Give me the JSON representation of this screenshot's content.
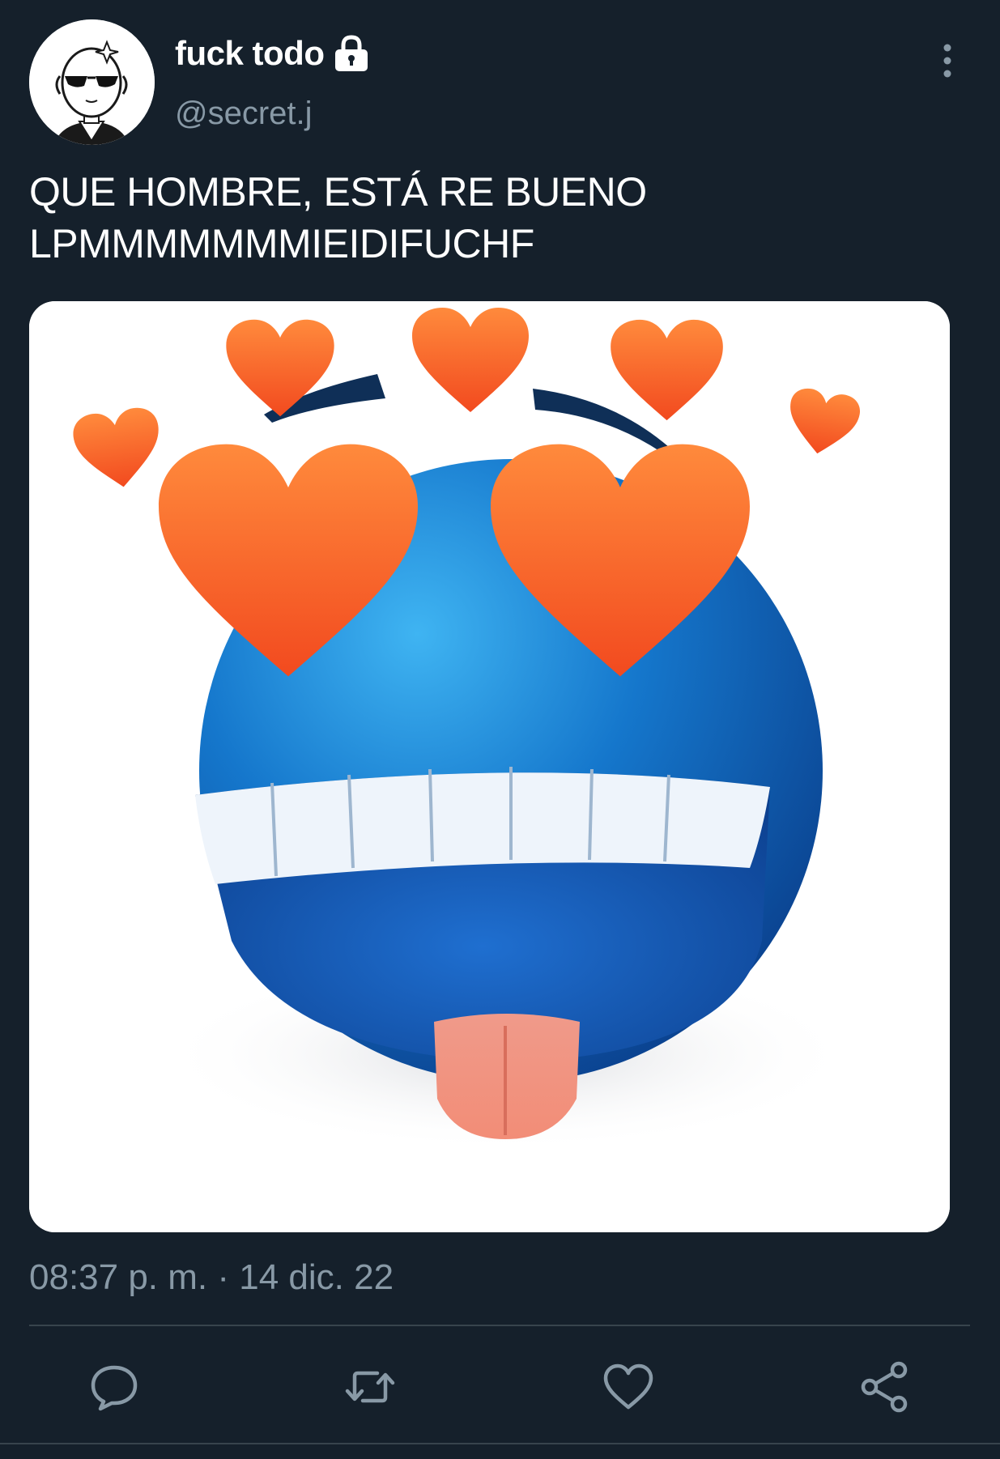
{
  "author": {
    "display_name": "fuck todo",
    "handle": "@secret.j",
    "avatar_icon": "avatar-sunglasses-character",
    "protected_icon": "lock-icon"
  },
  "tweet": {
    "text_lines": [
      "QUE HOMBRE, ESTÁ RE BUENO",
      "LPMMMMMMMIEIDIFUCHF"
    ],
    "media_icon": "heart-eyes-blue-emoji"
  },
  "meta": {
    "timestamp": "08:37 p. m. · 14 dic. 22"
  },
  "actions": [
    {
      "name": "reply",
      "icon": "reply-icon"
    },
    {
      "name": "retweet",
      "icon": "retweet-icon"
    },
    {
      "name": "like",
      "icon": "heart-icon"
    },
    {
      "name": "share",
      "icon": "share-icon"
    }
  ],
  "colors": {
    "background": "#15202b",
    "secondary_text": "#8899a6",
    "primary_text": "#ffffff",
    "divider": "#38444d"
  }
}
